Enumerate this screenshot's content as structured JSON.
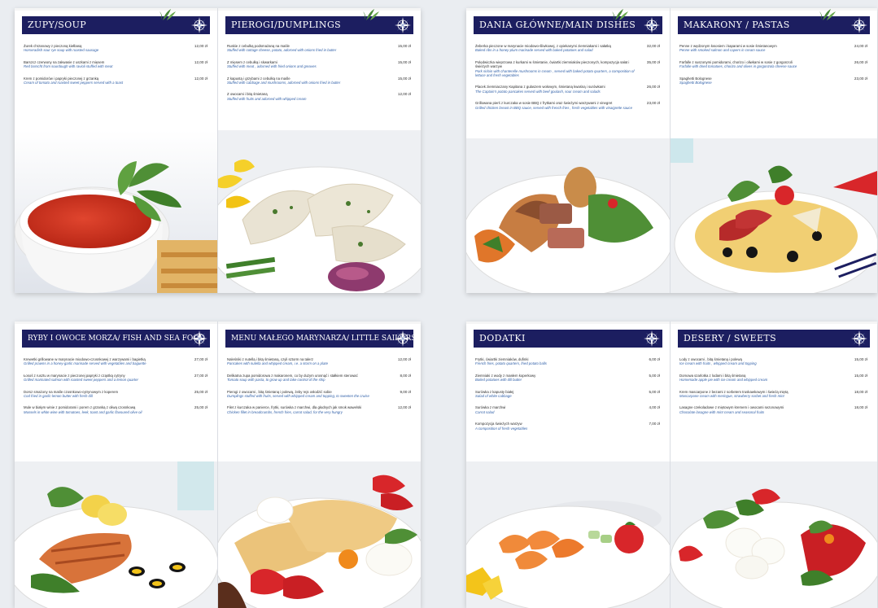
{
  "pages": [
    {
      "title": "Zupy/Soup",
      "long": false,
      "items": [
        {
          "name": "Żurek chrzanowy z pieczoną kiełbasą",
          "translation": "Horseradish sour rye soup with roasted sausage",
          "price": "12,00 zł"
        },
        {
          "name": "Barszcz czerwony na zakwasie z uszkami z mięsem",
          "translation": "Red borscht from sourdough with ravioli stuffed with meat",
          "price": "12,00 zł"
        },
        {
          "name": "Krem z pomidorów i papryki pieczonej z grzanką",
          "translation": "Cream of tomato and roasted sweet peppers served with a toast",
          "price": "12,00 zł"
        }
      ]
    },
    {
      "title": "Pierogi/Dumplings",
      "long": false,
      "items": [
        {
          "name": "Ruskie z cebulką podsmażaną na maśle",
          "translation": "Stuffed with cottage cheese, potato, adorned with onions fried in butter",
          "price": "15,00 zł"
        },
        {
          "name": "Z mięsem z cebulką i skwarkami",
          "translation": "Stuffed with meat , adorned with fried onions and greaves",
          "price": "15,00 zł"
        },
        {
          "name": "Z kapustą i grzybami z cebulką na maśle",
          "translation": "Stuffed with cabbage and mushrooms, adorned with onions fried in butter",
          "price": "15,00 zł"
        },
        {
          "name": "Z owocami i bitą śmietaną",
          "translation": "Stuffed with fruits and adorned with whipped cream",
          "price": "12,00 zł"
        }
      ]
    },
    {
      "title": "Dania Główne/Main Dishes",
      "long": false,
      "items": [
        {
          "name": "Żeberka pieczone w marynacie miodowo-śliwkowej, z opiekanymi ziemniakami i sałatką",
          "translation": "Baked ribs in a honey-plum marinade served with baked potatoes and salad",
          "price": "32,00 zł"
        },
        {
          "name": "Polędwiczka wieprzowa z kurkami w śmietanie, ćwiartki ziemniaków pieczonych, kompozycja sałat i świeżych warzyw",
          "translation": "Pork sirloin with chanterelle mushrooms in cream , served with baked potato quarters, a composition of lettuce and fresh vegetables",
          "price": "35,00 zł"
        },
        {
          "name": "Placek ziemniaczany Kapitana z gulaszem wołowym, śmietaną kwaśną i surówkami",
          "translation": "The Captain's potato pancakes served with beef goulash, sour cream and salads",
          "price": "26,00 zł"
        },
        {
          "name": "Grillowana pierś z kurczaka w sosie BBQ z frytkami oraz świeżymi warzywami z vinegret",
          "translation": "Grilled chicken breast in BBQ sauce, served with french fries , fresh vegetables with vinaigrette sauce",
          "price": "23,00 zł"
        }
      ]
    },
    {
      "title": "Makarony / Pastas",
      "long": false,
      "items": [
        {
          "name": "Penne z wędzonym łososiem i kaparami w sosie śmietanowym",
          "translation": "Penne with smoked salmon and capers in cream sauce",
          "price": "24,00 zł"
        },
        {
          "name": "Farfalle z suszonymi pomidorami, chorizo i oliwkami w sosie z gorgonzoli",
          "translation": "Farfalle with dried tomatoes, chorizo and olives in gorgonzola cheese sauce",
          "price": "26,00 zł"
        },
        {
          "name": "Spaghetti Bolognese",
          "translation": "Spaghetti Bolognese",
          "price": "23,00 zł"
        }
      ]
    },
    {
      "title": "Ryby i owoce morza/ Fish and Sea Food",
      "long": true,
      "items": [
        {
          "name": "Krewetki grillowane w marynacie miodowo-czosnkowej z warzywami i bagietką",
          "translation": "Grilled prawns in a honey-garlic marinade served with vegetables and baguette",
          "price": "27,00 zł"
        },
        {
          "name": "Łosoś z rusztu w marynacie z pieczonej papryki z cząstką cytryny",
          "translation": "Grilled marinated salmon with roasted sweet peppers and a lemon quarter",
          "price": "27,00 zł"
        },
        {
          "name": "Dorsz smażony na maśle czosnkowo-cytrynowym z koperem",
          "translation": "Cod fried in garlic-lemon butter with fresh dill",
          "price": "25,00 zł"
        },
        {
          "name": "Mule w białym winie z pomidorami i porem z grzanką z oliwą czosnkową",
          "translation": "Mussels in white wine with tomatoes, leek, toast and garlic flavoured olive oil",
          "price": "25,00 zł"
        }
      ]
    },
    {
      "title": "Menu małego marynarza/ Little sailors' menu",
      "long": true,
      "items": [
        {
          "name": "Naleśniki z nutellą i bitą śmietaną, czyli sztorm na talerz",
          "translation": "Pancakes with nutella and whipped cream, i.e. a storm on a plate",
          "price": "12,00 zł"
        },
        {
          "name": "Delikatna zupa pomidorowa z makaronem, co by dużym urosnąć i stałkiem sterować",
          "translation": "Tomato soup with pasta, to grow up and take control of the ship",
          "price": "8,00 zł"
        },
        {
          "name": "Pierogi z owocami , bitą śmietaną i polewą, żeby rejs osłodzić sobie",
          "translation": "Dumplings stuffed with fruits, served with whipped cream and topping, to sweeten the cruise",
          "price": "9,00 zł"
        },
        {
          "name": "Filet z kurczaka w panierce, frytki, surówka z marchwi, dla głodnych jak smok wawelski",
          "translation": "Chicken fillet in breadcrumbs, french fries, carrot salad, for the very hungry",
          "price": "12,00 zł"
        }
      ]
    },
    {
      "title": "Dodatki",
      "long": false,
      "items": [
        {
          "name": "Frytki, ćwiartki ziemniaków, dufinki",
          "translation": "French fries, potato quarters, fried potato balls",
          "price": "6,00 zł"
        },
        {
          "name": "Ziemniaki z wody z masłem koperkowy",
          "translation": "Boiled potatoes with dill butter",
          "price": "5,00 zł"
        },
        {
          "name": "Surówka z kapusty białej",
          "translation": "Salad of white cabbage",
          "price": "5,00 zł"
        },
        {
          "name": "Surówka z marchwi",
          "translation": "Carrot salad",
          "price": "4,00 zł"
        },
        {
          "name": "Kompozycja świeżych warzyw",
          "translation": "A composition of fresh vegetables",
          "price": "7,00 zł"
        }
      ]
    },
    {
      "title": "Desery / Sweets",
      "long": false,
      "items": [
        {
          "name": "Lody z owocami , bitą śmietaną i polewą",
          "translation": "Ice cream with fruits , whipped cream and topping",
          "price": "15,00 zł"
        },
        {
          "name": "Domowa szarlotka z lodami i bitą śmietaną",
          "translation": "Homemade apple pie with ice cream and whipped cream",
          "price": "15,00 zł"
        },
        {
          "name": "Krem mascarpone z bezami z sorbetem truskawkowym i świeżą miętą",
          "translation": "Mascarpone cream with meringue, strawberry sorbet and fresh mint",
          "price": "18,00 zł"
        },
        {
          "name": "Lasagne czekoladowe z miętowym kremem i owocami sezonowymi",
          "translation": "Chocolate lasagne with mint cream and seasonal fruits",
          "price": "18,00 zł"
        }
      ]
    }
  ],
  "colors": {
    "banner": "#1c1e60",
    "translation": "#2f5fa8",
    "leaf": "#4a8a3a"
  }
}
